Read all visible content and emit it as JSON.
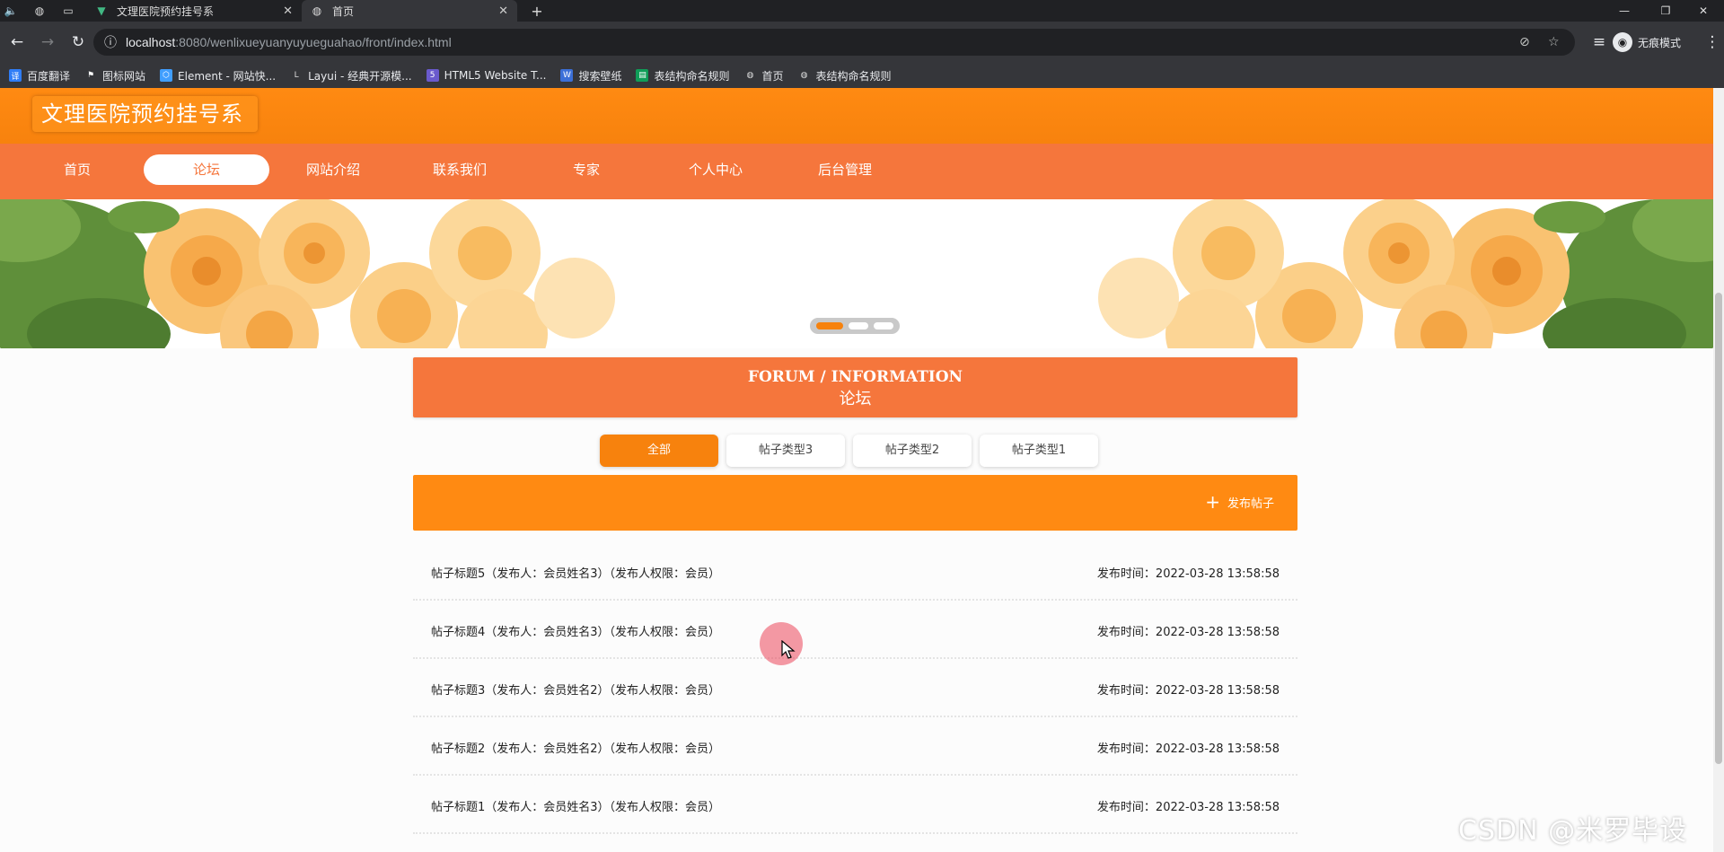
{
  "browser": {
    "tabs": [
      {
        "title": "文理医院预约挂号系",
        "active": false
      },
      {
        "title": "首页",
        "active": true
      }
    ],
    "url_host": "localhost",
    "url_rest": ":8080/wenlixueyuanyuyueguahao/front/index.html",
    "profile_label": "无痕模式",
    "bookmarks": [
      {
        "label": "百度翻译",
        "icon": "baidu-translate-icon"
      },
      {
        "label": "图标网站",
        "icon": "flag-icon"
      },
      {
        "label": "Element - 网站快...",
        "icon": "element-icon"
      },
      {
        "label": "Layui - 经典开源模...",
        "icon": "layui-icon"
      },
      {
        "label": "HTML5 Website T...",
        "icon": "html5-icon"
      },
      {
        "label": "搜索壁纸",
        "icon": "wallpaper-icon"
      },
      {
        "label": "表结构命名规则",
        "icon": "sheet-icon"
      },
      {
        "label": "首页",
        "icon": "globe-icon"
      },
      {
        "label": "表结构命名规则",
        "icon": "globe-icon"
      }
    ]
  },
  "site": {
    "title": "文理医院预约挂号系",
    "nav": [
      {
        "label": "首页",
        "active": false
      },
      {
        "label": "论坛",
        "active": true
      },
      {
        "label": "网站介绍",
        "active": false
      },
      {
        "label": "联系我们",
        "active": false
      },
      {
        "label": "专家",
        "active": false
      },
      {
        "label": "个人中心",
        "active": false
      },
      {
        "label": "后台管理",
        "active": false
      }
    ],
    "banner": {
      "slides": 3,
      "active_slide": 1
    }
  },
  "forum": {
    "heading_en": "FORUM / INFORMATION",
    "heading_cn": "论坛",
    "filters": [
      {
        "label": "全部",
        "active": true
      },
      {
        "label": "帖子类型3",
        "active": false
      },
      {
        "label": "帖子类型2",
        "active": false
      },
      {
        "label": "帖子类型1",
        "active": false
      }
    ],
    "post_button": "发布帖子",
    "posts": [
      {
        "title": "帖子标题5（发布人：会员姓名3）（发布人权限：会员）",
        "time": "发布时间：2022-03-28 13:58:58"
      },
      {
        "title": "帖子标题4（发布人：会员姓名3）（发布人权限：会员）",
        "time": "发布时间：2022-03-28 13:58:58"
      },
      {
        "title": "帖子标题3（发布人：会员姓名2）（发布人权限：会员）",
        "time": "发布时间：2022-03-28 13:58:58"
      },
      {
        "title": "帖子标题2（发布人：会员姓名2）（发布人权限：会员）",
        "time": "发布时间：2022-03-28 13:58:58"
      },
      {
        "title": "帖子标题1（发布人：会员姓名3）（发布人权限：会员）",
        "time": "发布时间：2022-03-28 13:58:58"
      }
    ]
  },
  "watermark": "CSDN @米罗毕设",
  "colors": {
    "header_orange": "#ff8a12",
    "nav_orange": "#f5763c",
    "chrome_dark": "#202124",
    "chrome_mid": "#35363a"
  }
}
